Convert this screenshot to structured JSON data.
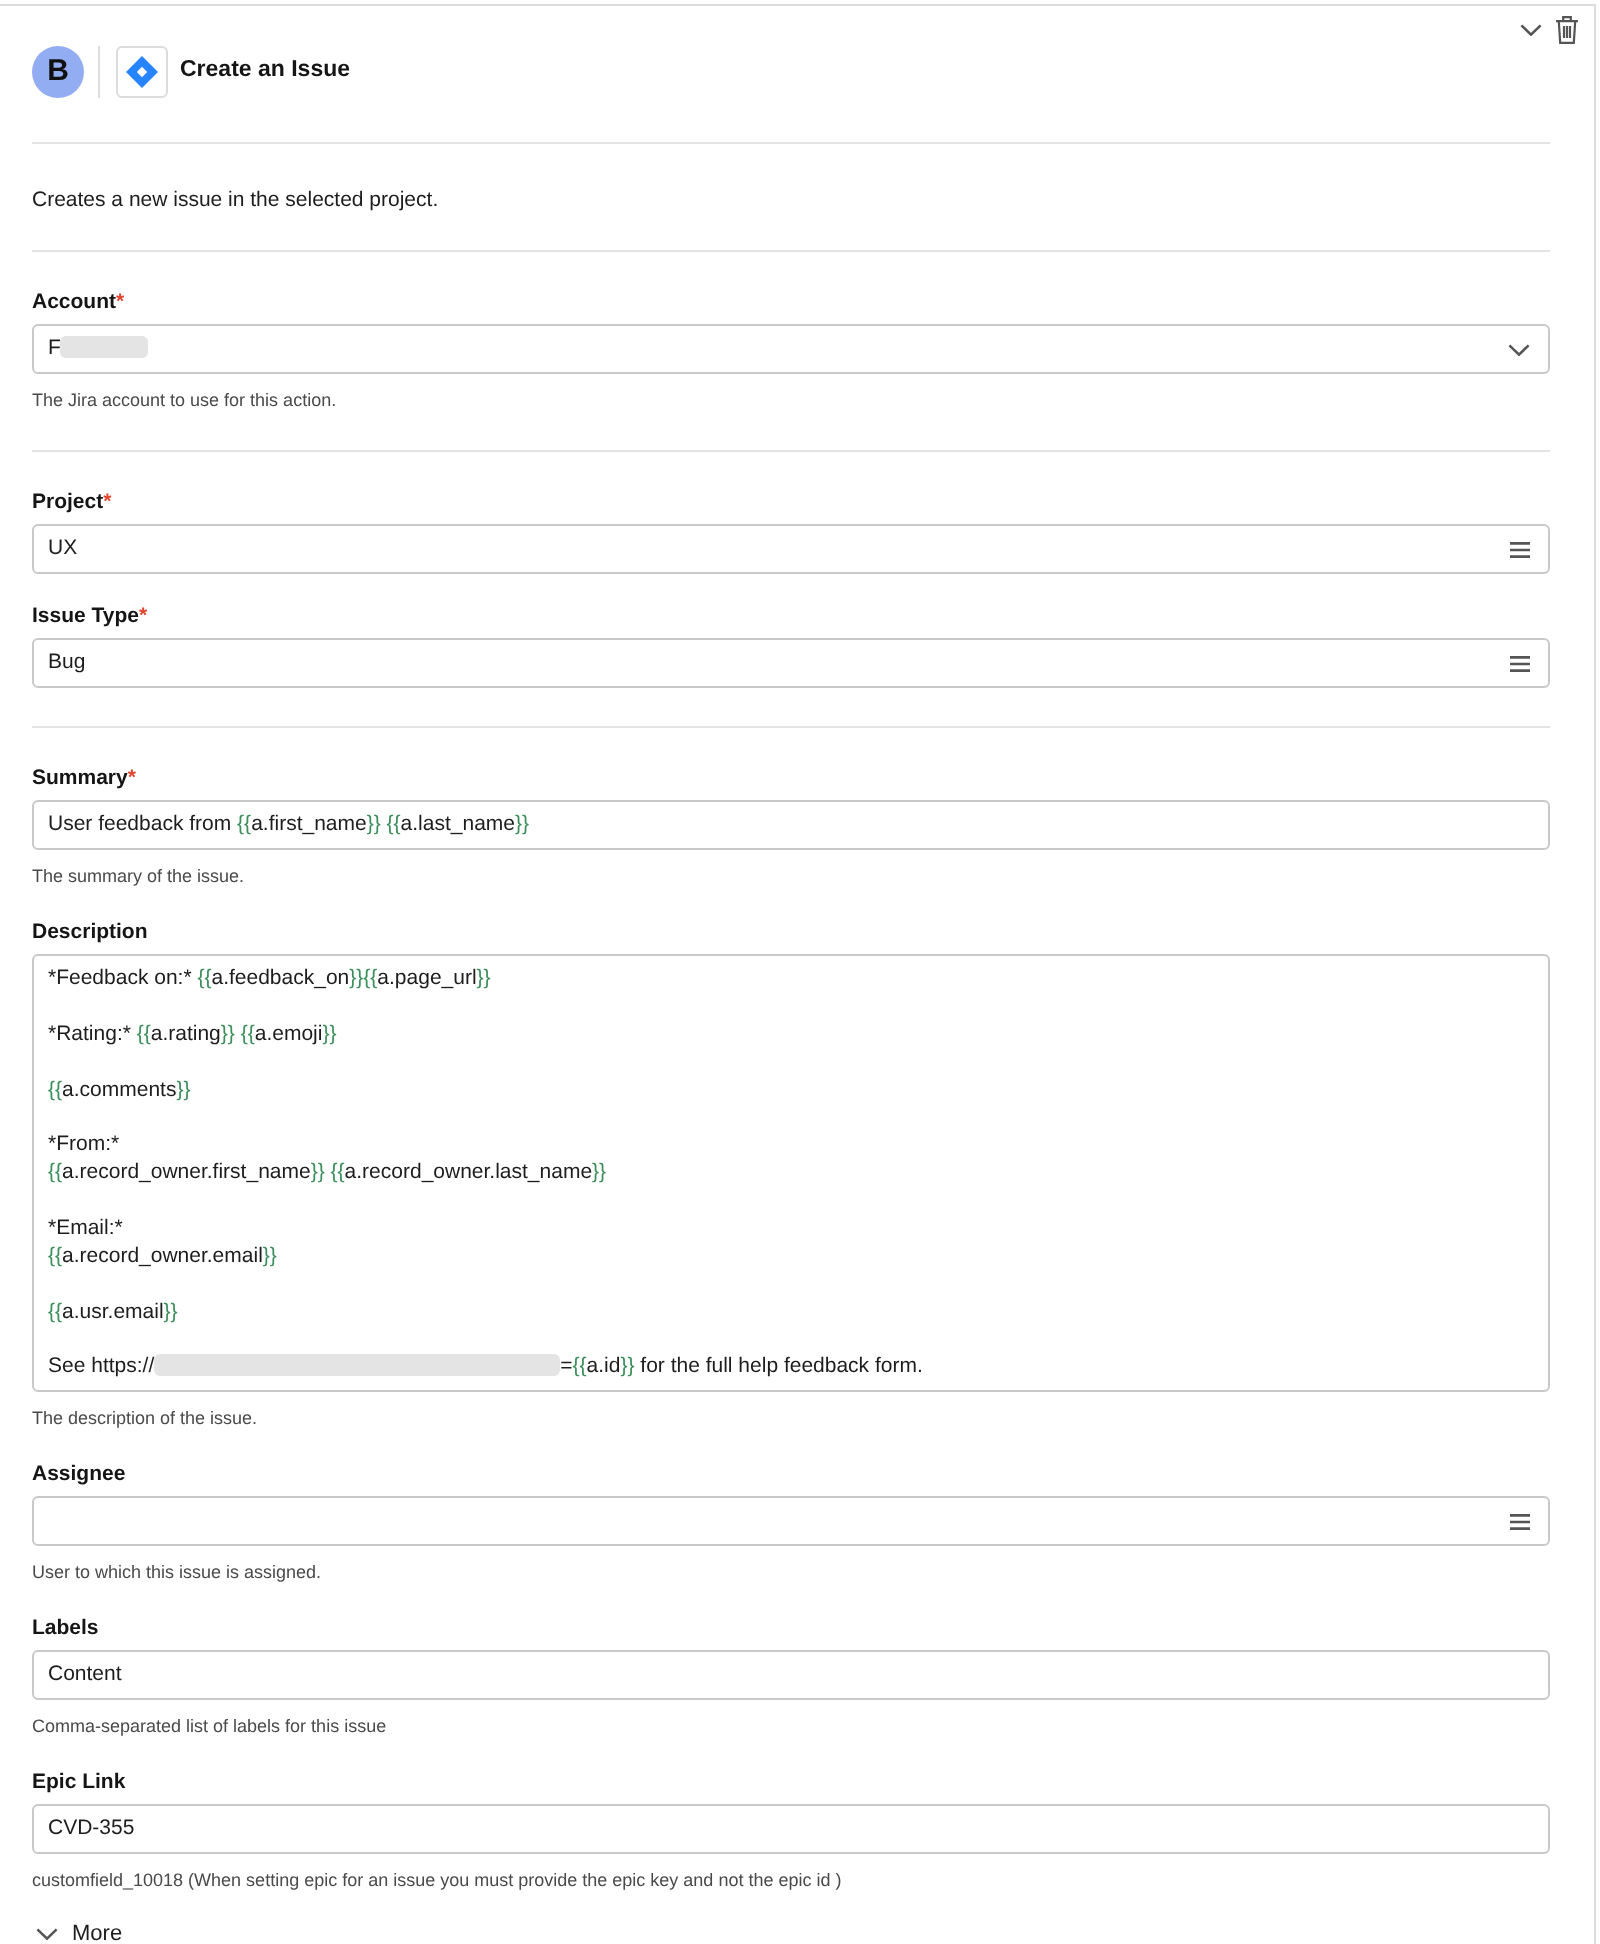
{
  "header": {
    "avatar_letter": "B",
    "title": "Create an Issue"
  },
  "intro": "Creates a new issue in the selected project.",
  "sections": [
    {
      "fields": [
        {
          "label": "Account",
          "required_mark": "*",
          "kind": "select",
          "value": [
            {
              "kind": "text",
              "text": "F"
            },
            {
              "kind": "redacted"
            }
          ],
          "help": "The Jira account to use for this action."
        }
      ]
    },
    {
      "fields": [
        {
          "label": "Project",
          "required_mark": "*",
          "kind": "lookup",
          "value": [
            {
              "kind": "text",
              "text": "UX"
            }
          ]
        },
        {
          "label": "Issue Type",
          "required_mark": "*",
          "kind": "lookup",
          "value": [
            {
              "kind": "text",
              "text": "Bug"
            }
          ]
        }
      ]
    },
    {
      "fields": [
        {
          "label": "Summary",
          "required_mark": "*",
          "kind": "text",
          "value": [
            {
              "kind": "text",
              "text": "User feedback from "
            },
            {
              "kind": "var",
              "open": "{{",
              "name": "a.first_name",
              "close": "}}"
            },
            {
              "kind": "var",
              "open": " {{",
              "name": "a.last_name",
              "close": "}}"
            }
          ],
          "help": "The summary of the issue."
        },
        {
          "label": "Description",
          "kind": "textarea",
          "paragraphs": [
            [
              [
                {
                  "kind": "text",
                  "text": "*Feedback on:* "
                },
                {
                  "kind": "var",
                  "open": "{{",
                  "name": "a.feedback_on",
                  "close": "}}"
                },
                {
                  "kind": "var",
                  "open": "{{",
                  "name": "a.page_url",
                  "close": "}}"
                }
              ]
            ],
            [
              [
                {
                  "kind": "text",
                  "text": "*Rating:* "
                },
                {
                  "kind": "var",
                  "open": "{{",
                  "name": "a.rating",
                  "close": "}}"
                },
                {
                  "kind": "var",
                  "open": " {{",
                  "name": "a.emoji",
                  "close": "}}"
                }
              ]
            ],
            [
              [
                {
                  "kind": "var",
                  "open": "{{",
                  "name": "a.comments",
                  "close": "}}"
                }
              ]
            ],
            [
              [
                {
                  "kind": "text",
                  "text": "*From:*"
                }
              ],
              [
                {
                  "kind": "var",
                  "open": "{{",
                  "name": "a.record_owner.first_name",
                  "close": "}}"
                },
                {
                  "kind": "var",
                  "open": " {{",
                  "name": "a.record_owner.last_name",
                  "close": "}}"
                }
              ]
            ],
            [
              [
                {
                  "kind": "text",
                  "text": "*Email:*"
                }
              ],
              [
                {
                  "kind": "var",
                  "open": "{{",
                  "name": "a.record_owner.email",
                  "close": "}}"
                }
              ]
            ],
            [
              [
                {
                  "kind": "var",
                  "open": "{{",
                  "name": "a.usr.email",
                  "close": "}}"
                }
              ]
            ],
            [
              [
                {
                  "kind": "text",
                  "text": "See https://"
                },
                {
                  "kind": "redacted"
                },
                {
                  "kind": "text",
                  "text": "="
                },
                {
                  "kind": "var",
                  "open": "{{",
                  "name": "a.id",
                  "close": "}}"
                },
                {
                  "kind": "text",
                  "text": " for the full help feedback form."
                }
              ]
            ]
          ],
          "help": "The description of the issue."
        },
        {
          "label": "Assignee",
          "kind": "lookup",
          "help": "User to which this issue is assigned."
        },
        {
          "label": "Labels",
          "kind": "text",
          "value": [
            {
              "kind": "text",
              "text": "Content"
            }
          ],
          "help": "Comma-separated list of labels for this issue"
        },
        {
          "label": "Epic Link",
          "kind": "text",
          "value": [
            {
              "kind": "text",
              "text": "CVD-355"
            }
          ],
          "help": "customfield_10018 (When setting epic for an issue you must provide the epic key and not the epic id )"
        }
      ]
    }
  ],
  "more_toggle": {
    "label": "More",
    "expanded": false
  }
}
